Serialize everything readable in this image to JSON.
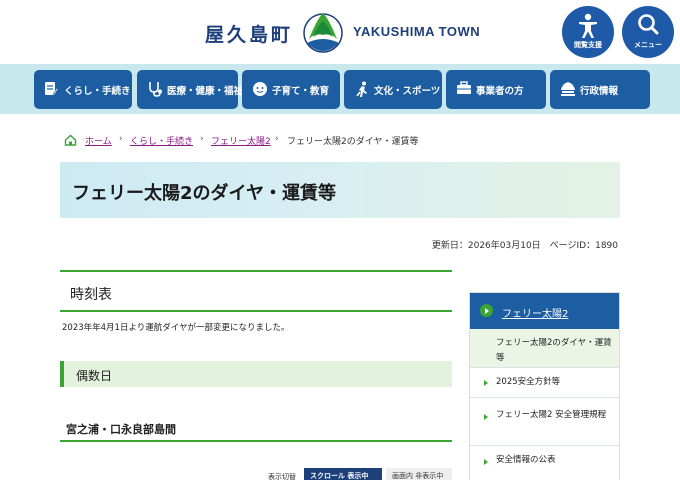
{
  "header": {
    "logo_jp": "屋久島町",
    "logo_en": "YAKUSHIMA TOWN",
    "accessibility_label": "閲覧支援",
    "menu_label": "メニュー"
  },
  "nav": {
    "items": [
      {
        "label": "くらし・手続き",
        "icon": "document-pen-icon"
      },
      {
        "label": "医療・健康・福祉",
        "icon": "stethoscope-icon"
      },
      {
        "label": "子育て・教育",
        "icon": "child-face-icon"
      },
      {
        "label": "文化・スポーツ",
        "icon": "runner-icon"
      },
      {
        "label": "事業者の方",
        "icon": "briefcase-icon"
      },
      {
        "label": "行政情報",
        "icon": "government-building-icon"
      }
    ]
  },
  "breadcrumb": {
    "home": "ホーム",
    "level1": "くらし・手続き",
    "level2": "フェリー太陽2",
    "current": "フェリー太陽2のダイヤ・運賃等",
    "separator": "›"
  },
  "page": {
    "title": "フェリー太陽2のダイヤ・運賃等",
    "updated": "更新日：2026年03月10日　ページID：1890"
  },
  "main": {
    "heading": "時刻表",
    "notice": "2023年年4月1日より運航ダイヤが一部変更になりました。",
    "subheading": "偶数日",
    "route_heading": "宮之浦・口永良部島間",
    "toggle": {
      "label": "表示切替",
      "scroll_on": "スクロール 表示中",
      "inline_off": "画面内 非表示中"
    }
  },
  "sidebar": {
    "head": "フェリー太陽2",
    "active_item": "フェリー太陽2のダイヤ・運賃等",
    "items": [
      "2025安全方針等",
      "フェリー太陽2 安全管理規程",
      "安全情報の公表"
    ]
  },
  "colors": {
    "primary_blue": "#1d5ea2",
    "accent_green": "#3aa535",
    "nav_band": "#c9e8ee",
    "link_purple": "#8a1a8a"
  }
}
